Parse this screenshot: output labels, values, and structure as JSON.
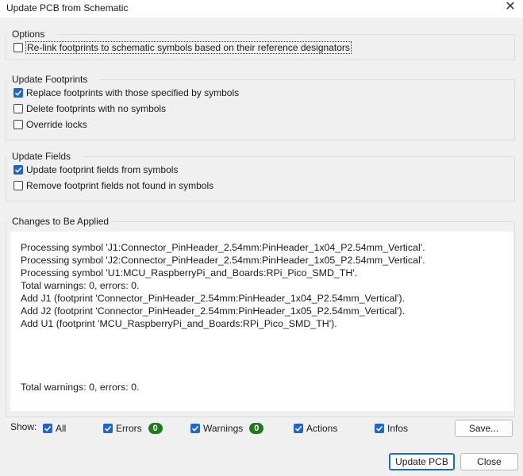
{
  "window": {
    "title": "Update PCB from Schematic",
    "close_glyph": "✕"
  },
  "options": {
    "title": "Options",
    "relink": {
      "label": "Re-link footprints to schematic symbols based on their reference designators",
      "checked": false
    }
  },
  "update_footprints": {
    "title": "Update Footprints",
    "items": [
      {
        "label": "Replace footprints with those specified by symbols",
        "checked": true
      },
      {
        "label": "Delete footprints with no symbols",
        "checked": false
      },
      {
        "label": "Override locks",
        "checked": false
      }
    ]
  },
  "update_fields": {
    "title": "Update Fields",
    "items": [
      {
        "label": "Update footprint fields from symbols",
        "checked": true
      },
      {
        "label": "Remove footprint fields not found in symbols",
        "checked": false
      }
    ]
  },
  "changes": {
    "title": "Changes to Be Applied",
    "lines": [
      "Processing symbol 'J1:Connector_PinHeader_2.54mm:PinHeader_1x04_P2.54mm_Vertical'.",
      "Processing symbol 'J2:Connector_PinHeader_2.54mm:PinHeader_1x05_P2.54mm_Vertical'.",
      "Processing symbol 'U1:MCU_RaspberryPi_and_Boards:RPi_Pico_SMD_TH'.",
      "Total warnings: 0, errors: 0.",
      "Add J1 (footprint 'Connector_PinHeader_2.54mm:PinHeader_1x04_P2.54mm_Vertical').",
      "Add J2 (footprint 'Connector_PinHeader_2.54mm:PinHeader_1x05_P2.54mm_Vertical').",
      "Add U1 (footprint 'MCU_RaspberryPi_and_Boards:RPi_Pico_SMD_TH')."
    ],
    "summary": "Total warnings: 0, errors: 0."
  },
  "filters": {
    "show_label": "Show:",
    "all": {
      "label": "All",
      "checked": true
    },
    "errors": {
      "label": "Errors",
      "checked": true,
      "count": "0"
    },
    "warnings": {
      "label": "Warnings",
      "checked": true,
      "count": "0"
    },
    "actions": {
      "label": "Actions",
      "checked": true
    },
    "infos": {
      "label": "Infos",
      "checked": true
    },
    "save_label": "Save..."
  },
  "buttons": {
    "update_label": "Update PCB",
    "close_label": "Close"
  },
  "colors": {
    "accent": "#1e66c9",
    "badge": "#1f7a1f"
  }
}
